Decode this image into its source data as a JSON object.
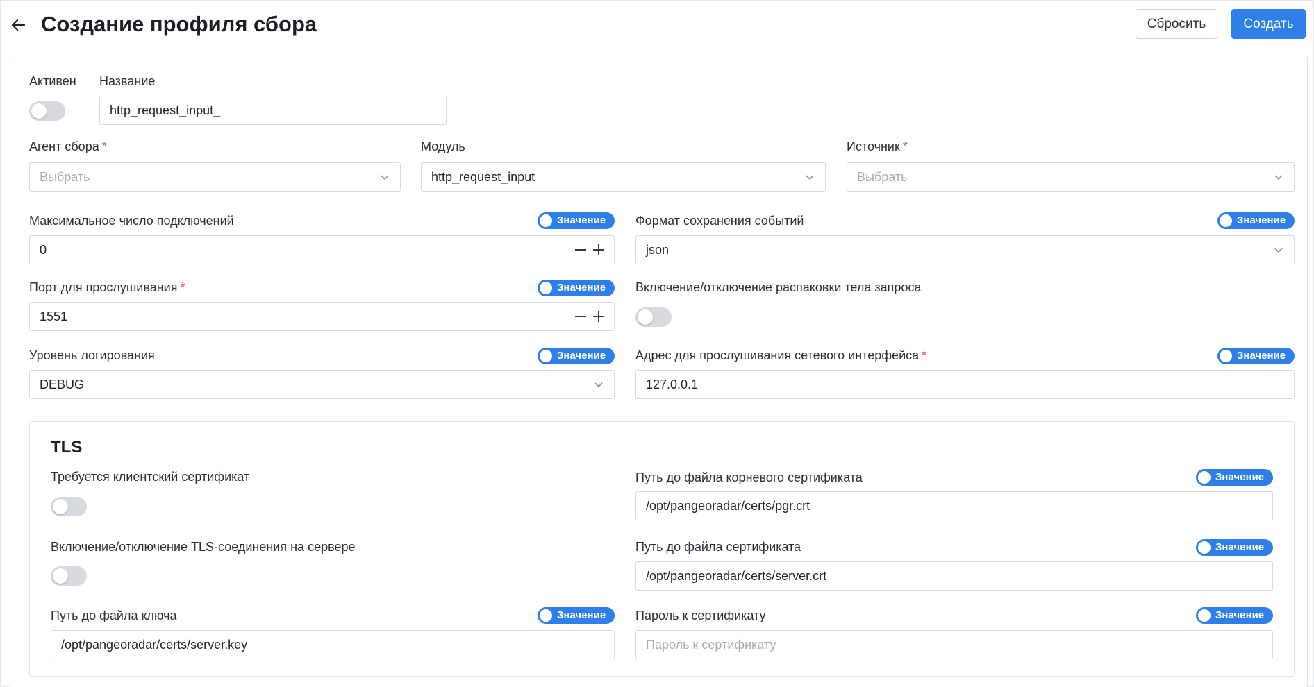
{
  "header": {
    "title": "Создание профиля сбора",
    "reset_label": "Сбросить",
    "create_label": "Создать"
  },
  "form": {
    "active": {
      "label": "Активен",
      "on": false
    },
    "name": {
      "label": "Название",
      "value": "http_request_input_"
    },
    "agent": {
      "label": "Агент сбора",
      "required": "*",
      "placeholder": "Выбрать"
    },
    "module": {
      "label": "Модуль",
      "value": "http_request_input"
    },
    "source": {
      "label": "Источник",
      "required": "*",
      "placeholder": "Выбрать"
    },
    "max_connections": {
      "label": "Максимальное число подключений",
      "switch": "Значение",
      "value": "0"
    },
    "event_format": {
      "label": "Формат сохранения событий",
      "switch": "Значение",
      "value": "json"
    },
    "listen_port": {
      "label": "Порт для прослушивания",
      "required": "*",
      "switch": "Значение",
      "value": "1551"
    },
    "decompress": {
      "label": "Включение/отключение распаковки тела запроса",
      "on": false
    },
    "log_level": {
      "label": "Уровень логирования",
      "switch": "Значение",
      "value": "DEBUG"
    },
    "listen_address": {
      "label": "Адрес для прослушивания сетевого интерфейса",
      "required": "*",
      "switch": "Значение",
      "value": "127.0.0.1"
    }
  },
  "tls": {
    "title": "TLS",
    "client_cert": {
      "label": "Требуется клиентский сертификат",
      "on": false
    },
    "tls_server": {
      "label": "Включение/отключение TLS-соединения на сервере",
      "on": false
    },
    "key_path": {
      "label": "Путь до файла ключа",
      "switch": "Значение",
      "value": "/opt/pangeoradar/certs/server.key"
    },
    "root_cert_path": {
      "label": "Путь до файла корневого сертификата",
      "switch": "Значение",
      "value": "/opt/pangeoradar/certs/pgr.crt"
    },
    "cert_path": {
      "label": "Путь до файла сертификата",
      "switch": "Значение",
      "value": "/opt/pangeoradar/certs/server.crt"
    },
    "cert_password": {
      "label": "Пароль к сертификату",
      "switch": "Значение",
      "placeholder": "Пароль к сертификату"
    }
  },
  "colors": {
    "accent": "#2f7fe8",
    "required": "#e5484d",
    "toggle_off": "#d6d9de"
  },
  "icons": {
    "back": "arrow-left-icon",
    "dropdown": "chevron-down-icon",
    "minus": "minus-icon",
    "plus": "plus-icon"
  }
}
